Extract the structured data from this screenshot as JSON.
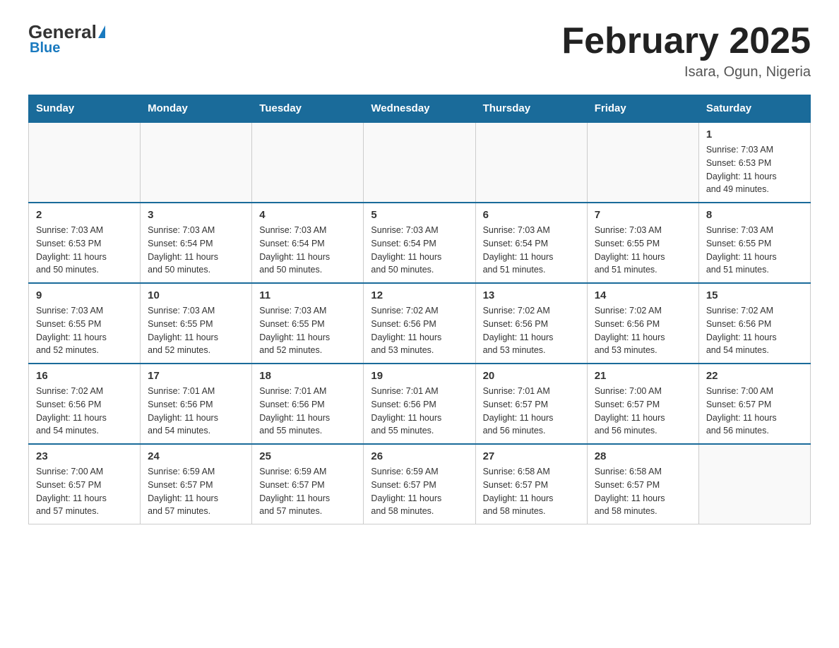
{
  "logo": {
    "general": "General",
    "arrow": "▲",
    "blue": "Blue"
  },
  "header": {
    "title": "February 2025",
    "subtitle": "Isara, Ogun, Nigeria"
  },
  "days_of_week": [
    "Sunday",
    "Monday",
    "Tuesday",
    "Wednesday",
    "Thursday",
    "Friday",
    "Saturday"
  ],
  "weeks": [
    {
      "days": [
        {
          "num": "",
          "info": ""
        },
        {
          "num": "",
          "info": ""
        },
        {
          "num": "",
          "info": ""
        },
        {
          "num": "",
          "info": ""
        },
        {
          "num": "",
          "info": ""
        },
        {
          "num": "",
          "info": ""
        },
        {
          "num": "1",
          "info": "Sunrise: 7:03 AM\nSunset: 6:53 PM\nDaylight: 11 hours\nand 49 minutes."
        }
      ]
    },
    {
      "days": [
        {
          "num": "2",
          "info": "Sunrise: 7:03 AM\nSunset: 6:53 PM\nDaylight: 11 hours\nand 50 minutes."
        },
        {
          "num": "3",
          "info": "Sunrise: 7:03 AM\nSunset: 6:54 PM\nDaylight: 11 hours\nand 50 minutes."
        },
        {
          "num": "4",
          "info": "Sunrise: 7:03 AM\nSunset: 6:54 PM\nDaylight: 11 hours\nand 50 minutes."
        },
        {
          "num": "5",
          "info": "Sunrise: 7:03 AM\nSunset: 6:54 PM\nDaylight: 11 hours\nand 50 minutes."
        },
        {
          "num": "6",
          "info": "Sunrise: 7:03 AM\nSunset: 6:54 PM\nDaylight: 11 hours\nand 51 minutes."
        },
        {
          "num": "7",
          "info": "Sunrise: 7:03 AM\nSunset: 6:55 PM\nDaylight: 11 hours\nand 51 minutes."
        },
        {
          "num": "8",
          "info": "Sunrise: 7:03 AM\nSunset: 6:55 PM\nDaylight: 11 hours\nand 51 minutes."
        }
      ]
    },
    {
      "days": [
        {
          "num": "9",
          "info": "Sunrise: 7:03 AM\nSunset: 6:55 PM\nDaylight: 11 hours\nand 52 minutes."
        },
        {
          "num": "10",
          "info": "Sunrise: 7:03 AM\nSunset: 6:55 PM\nDaylight: 11 hours\nand 52 minutes."
        },
        {
          "num": "11",
          "info": "Sunrise: 7:03 AM\nSunset: 6:55 PM\nDaylight: 11 hours\nand 52 minutes."
        },
        {
          "num": "12",
          "info": "Sunrise: 7:02 AM\nSunset: 6:56 PM\nDaylight: 11 hours\nand 53 minutes."
        },
        {
          "num": "13",
          "info": "Sunrise: 7:02 AM\nSunset: 6:56 PM\nDaylight: 11 hours\nand 53 minutes."
        },
        {
          "num": "14",
          "info": "Sunrise: 7:02 AM\nSunset: 6:56 PM\nDaylight: 11 hours\nand 53 minutes."
        },
        {
          "num": "15",
          "info": "Sunrise: 7:02 AM\nSunset: 6:56 PM\nDaylight: 11 hours\nand 54 minutes."
        }
      ]
    },
    {
      "days": [
        {
          "num": "16",
          "info": "Sunrise: 7:02 AM\nSunset: 6:56 PM\nDaylight: 11 hours\nand 54 minutes."
        },
        {
          "num": "17",
          "info": "Sunrise: 7:01 AM\nSunset: 6:56 PM\nDaylight: 11 hours\nand 54 minutes."
        },
        {
          "num": "18",
          "info": "Sunrise: 7:01 AM\nSunset: 6:56 PM\nDaylight: 11 hours\nand 55 minutes."
        },
        {
          "num": "19",
          "info": "Sunrise: 7:01 AM\nSunset: 6:56 PM\nDaylight: 11 hours\nand 55 minutes."
        },
        {
          "num": "20",
          "info": "Sunrise: 7:01 AM\nSunset: 6:57 PM\nDaylight: 11 hours\nand 56 minutes."
        },
        {
          "num": "21",
          "info": "Sunrise: 7:00 AM\nSunset: 6:57 PM\nDaylight: 11 hours\nand 56 minutes."
        },
        {
          "num": "22",
          "info": "Sunrise: 7:00 AM\nSunset: 6:57 PM\nDaylight: 11 hours\nand 56 minutes."
        }
      ]
    },
    {
      "days": [
        {
          "num": "23",
          "info": "Sunrise: 7:00 AM\nSunset: 6:57 PM\nDaylight: 11 hours\nand 57 minutes."
        },
        {
          "num": "24",
          "info": "Sunrise: 6:59 AM\nSunset: 6:57 PM\nDaylight: 11 hours\nand 57 minutes."
        },
        {
          "num": "25",
          "info": "Sunrise: 6:59 AM\nSunset: 6:57 PM\nDaylight: 11 hours\nand 57 minutes."
        },
        {
          "num": "26",
          "info": "Sunrise: 6:59 AM\nSunset: 6:57 PM\nDaylight: 11 hours\nand 58 minutes."
        },
        {
          "num": "27",
          "info": "Sunrise: 6:58 AM\nSunset: 6:57 PM\nDaylight: 11 hours\nand 58 minutes."
        },
        {
          "num": "28",
          "info": "Sunrise: 6:58 AM\nSunset: 6:57 PM\nDaylight: 11 hours\nand 58 minutes."
        },
        {
          "num": "",
          "info": ""
        }
      ]
    }
  ]
}
